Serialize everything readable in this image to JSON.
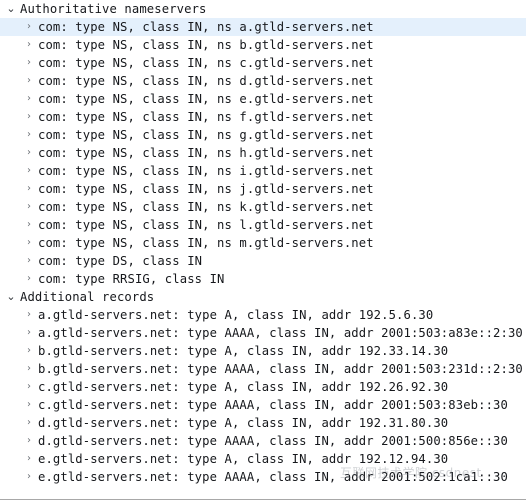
{
  "tree": {
    "sections": [
      {
        "label": "Authoritative nameservers",
        "expander_icon": "chevron-down-icon",
        "expanded": true,
        "children": [
          {
            "label": "com: type NS, class IN, ns a.gtld-servers.net",
            "expander_icon": "chevron-right-icon",
            "selected": true
          },
          {
            "label": "com: type NS, class IN, ns b.gtld-servers.net",
            "expander_icon": "chevron-right-icon",
            "selected": false
          },
          {
            "label": "com: type NS, class IN, ns c.gtld-servers.net",
            "expander_icon": "chevron-right-icon",
            "selected": false
          },
          {
            "label": "com: type NS, class IN, ns d.gtld-servers.net",
            "expander_icon": "chevron-right-icon",
            "selected": false
          },
          {
            "label": "com: type NS, class IN, ns e.gtld-servers.net",
            "expander_icon": "chevron-right-icon",
            "selected": false
          },
          {
            "label": "com: type NS, class IN, ns f.gtld-servers.net",
            "expander_icon": "chevron-right-icon",
            "selected": false
          },
          {
            "label": "com: type NS, class IN, ns g.gtld-servers.net",
            "expander_icon": "chevron-right-icon",
            "selected": false
          },
          {
            "label": "com: type NS, class IN, ns h.gtld-servers.net",
            "expander_icon": "chevron-right-icon",
            "selected": false
          },
          {
            "label": "com: type NS, class IN, ns i.gtld-servers.net",
            "expander_icon": "chevron-right-icon",
            "selected": false
          },
          {
            "label": "com: type NS, class IN, ns j.gtld-servers.net",
            "expander_icon": "chevron-right-icon",
            "selected": false
          },
          {
            "label": "com: type NS, class IN, ns k.gtld-servers.net",
            "expander_icon": "chevron-right-icon",
            "selected": false
          },
          {
            "label": "com: type NS, class IN, ns l.gtld-servers.net",
            "expander_icon": "chevron-right-icon",
            "selected": false
          },
          {
            "label": "com: type NS, class IN, ns m.gtld-servers.net",
            "expander_icon": "chevron-right-icon",
            "selected": false
          },
          {
            "label": "com: type DS, class IN",
            "expander_icon": "chevron-right-icon",
            "selected": false
          },
          {
            "label": "com: type RRSIG, class IN",
            "expander_icon": "chevron-right-icon",
            "selected": false
          }
        ]
      },
      {
        "label": "Additional records",
        "expander_icon": "chevron-down-icon",
        "expanded": true,
        "children": [
          {
            "label": "a.gtld-servers.net: type A, class IN, addr 192.5.6.30",
            "expander_icon": "chevron-right-icon",
            "selected": false
          },
          {
            "label": "a.gtld-servers.net: type AAAA, class IN, addr 2001:503:a83e::2:30",
            "expander_icon": "chevron-right-icon",
            "selected": false
          },
          {
            "label": "b.gtld-servers.net: type A, class IN, addr 192.33.14.30",
            "expander_icon": "chevron-right-icon",
            "selected": false
          },
          {
            "label": "b.gtld-servers.net: type AAAA, class IN, addr 2001:503:231d::2:30",
            "expander_icon": "chevron-right-icon",
            "selected": false
          },
          {
            "label": "c.gtld-servers.net: type A, class IN, addr 192.26.92.30",
            "expander_icon": "chevron-right-icon",
            "selected": false
          },
          {
            "label": "c.gtld-servers.net: type AAAA, class IN, addr 2001:503:83eb::30",
            "expander_icon": "chevron-right-icon",
            "selected": false
          },
          {
            "label": "d.gtld-servers.net: type A, class IN, addr 192.31.80.30",
            "expander_icon": "chevron-right-icon",
            "selected": false
          },
          {
            "label": "d.gtld-servers.net: type AAAA, class IN, addr 2001:500:856e::30",
            "expander_icon": "chevron-right-icon",
            "selected": false
          },
          {
            "label": "e.gtld-servers.net: type A, class IN, addr 192.12.94.30",
            "expander_icon": "chevron-right-icon",
            "selected": false
          },
          {
            "label": "e.gtld-servers.net: type AAAA, class IN, addr 2001:502:1ca1::30",
            "expander_icon": "chevron-right-icon",
            "selected": false
          }
        ]
      }
    ],
    "icons": {
      "chevron-down-icon": "⌄",
      "chevron-right-icon": "›"
    },
    "colors": {
      "selection": "#e4f0fc",
      "text": "#16181c",
      "expander": "#6d7278",
      "border": "#a8a8a8"
    }
  },
  "watermark": {
    "text": "互联网技术学院 csdnest"
  }
}
